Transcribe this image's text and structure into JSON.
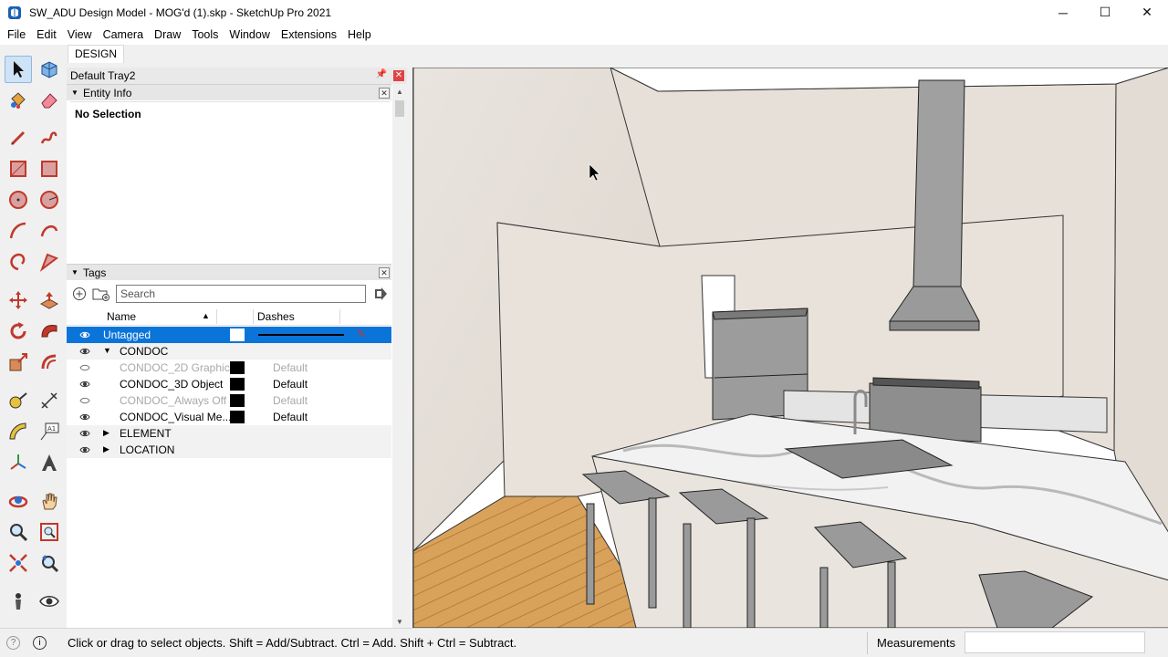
{
  "window": {
    "title": "SW_ADU Design Model - MOG'd (1).skp - SketchUp Pro 2021",
    "minimize": "─",
    "maximize": "☐",
    "close": "✕"
  },
  "menu": [
    "File",
    "Edit",
    "View",
    "Camera",
    "Draw",
    "Tools",
    "Window",
    "Extensions",
    "Help"
  ],
  "tab": "DESIGN",
  "tray": {
    "title": "Default Tray2",
    "entity_info": {
      "title": "Entity Info",
      "status": "No Selection"
    },
    "tags": {
      "title": "Tags",
      "search_placeholder": "Search",
      "columns": {
        "name": "Name",
        "dashes": "Dashes"
      },
      "rows": [
        {
          "name": "Untagged",
          "dashes": "",
          "color": "#ffffff",
          "visible": true,
          "selected": true,
          "level": 0
        },
        {
          "name": "CONDOC",
          "dashes": "",
          "color": "",
          "visible": true,
          "level": 0,
          "expander": "▼"
        },
        {
          "name": "CONDOC_2D Graphic",
          "dashes": "Default",
          "color": "#000000",
          "visible": false,
          "level": 1
        },
        {
          "name": "CONDOC_3D Object",
          "dashes": "Default",
          "color": "#000000",
          "visible": true,
          "level": 1
        },
        {
          "name": "CONDOC_Always Off",
          "dashes": "Default",
          "color": "#000000",
          "visible": false,
          "level": 1
        },
        {
          "name": "CONDOC_Visual Me...",
          "dashes": "Default",
          "color": "#000000",
          "visible": true,
          "level": 1
        },
        {
          "name": "ELEMENT",
          "dashes": "",
          "color": "",
          "visible": true,
          "level": 0,
          "expander": "▶"
        },
        {
          "name": "LOCATION",
          "dashes": "",
          "color": "",
          "visible": true,
          "level": 0,
          "expander": "▶"
        }
      ]
    }
  },
  "status": {
    "hint": "Click or drag to select objects. Shift = Add/Subtract. Ctrl = Add. Shift + Ctrl = Subtract.",
    "measurements_label": "Measurements",
    "measurements_value": ""
  },
  "colors": {
    "selection_blue": "#0a74d9",
    "close_red": "#e04343"
  }
}
